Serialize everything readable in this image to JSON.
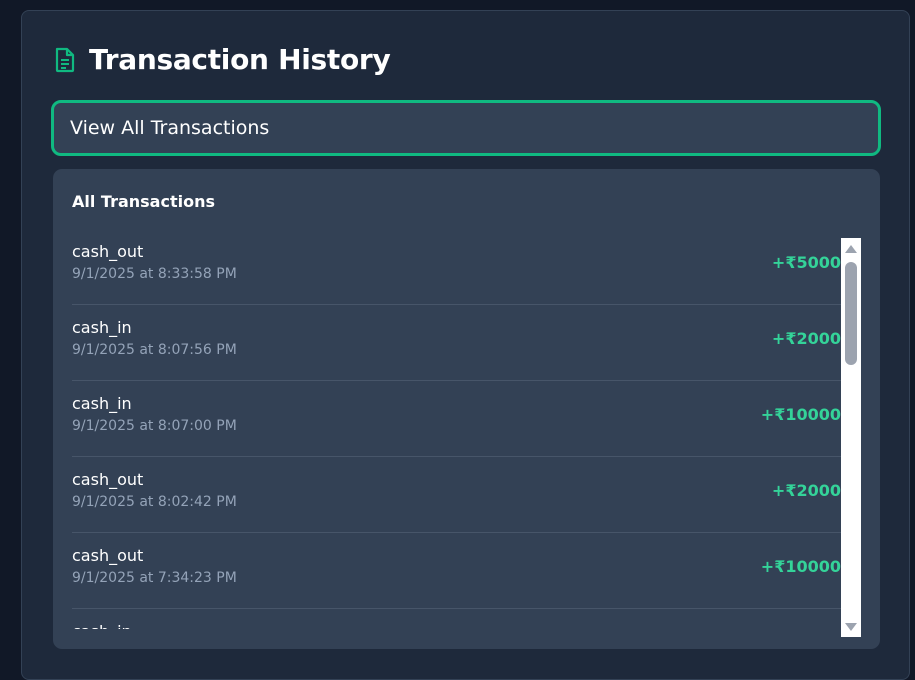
{
  "header": {
    "title": "Transaction History",
    "icon": "document-icon",
    "icon_color": "#10b981"
  },
  "view_button": {
    "label": "View All Transactions"
  },
  "panel": {
    "title": "All Transactions"
  },
  "transactions": [
    {
      "type": "cash_out",
      "date": "9/1/2025 at 8:33:58 PM",
      "amount": "+₹5000"
    },
    {
      "type": "cash_in",
      "date": "9/1/2025 at 8:07:56 PM",
      "amount": "+₹2000"
    },
    {
      "type": "cash_in",
      "date": "9/1/2025 at 8:07:00 PM",
      "amount": "+₹10000"
    },
    {
      "type": "cash_out",
      "date": "9/1/2025 at 8:02:42 PM",
      "amount": "+₹2000"
    },
    {
      "type": "cash_out",
      "date": "9/1/2025 at 7:34:23 PM",
      "amount": "+₹10000"
    },
    {
      "type": "cash_in",
      "date": "",
      "amount": ""
    }
  ],
  "colors": {
    "accent": "#10b981",
    "amount": "#34d399",
    "background": "#1e293b",
    "panel": "#334155"
  }
}
